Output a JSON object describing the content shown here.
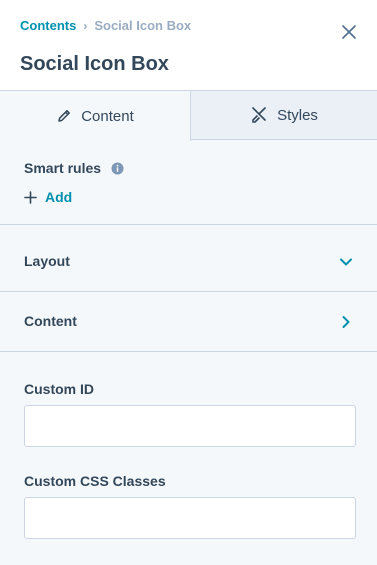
{
  "header": {
    "breadcrumb": {
      "parent": "Contents",
      "separator": "›",
      "current": "Social Icon Box"
    },
    "title": "Social Icon Box",
    "close_icon": "close-icon"
  },
  "tabs": [
    {
      "label": "Content",
      "icon": "pencil-icon",
      "active": true
    },
    {
      "label": "Styles",
      "icon": "brush-icon",
      "active": false
    }
  ],
  "smart_rules": {
    "label": "Smart rules",
    "info_icon": "info-icon",
    "add_label": "Add"
  },
  "sections": [
    {
      "label": "Layout",
      "icon": "chevron-down-icon"
    },
    {
      "label": "Content",
      "icon": "chevron-right-icon"
    }
  ],
  "fields": {
    "custom_id": {
      "label": "Custom ID",
      "value": "",
      "placeholder": ""
    },
    "custom_css": {
      "label": "Custom CSS Classes",
      "value": "",
      "placeholder": ""
    }
  },
  "colors": {
    "accent": "#0091ae",
    "text": "#33475b",
    "muted": "#99acc2",
    "border": "#cbd6e2",
    "background": "#f5f8fa",
    "inactive_tab": "#eaf0f6"
  }
}
